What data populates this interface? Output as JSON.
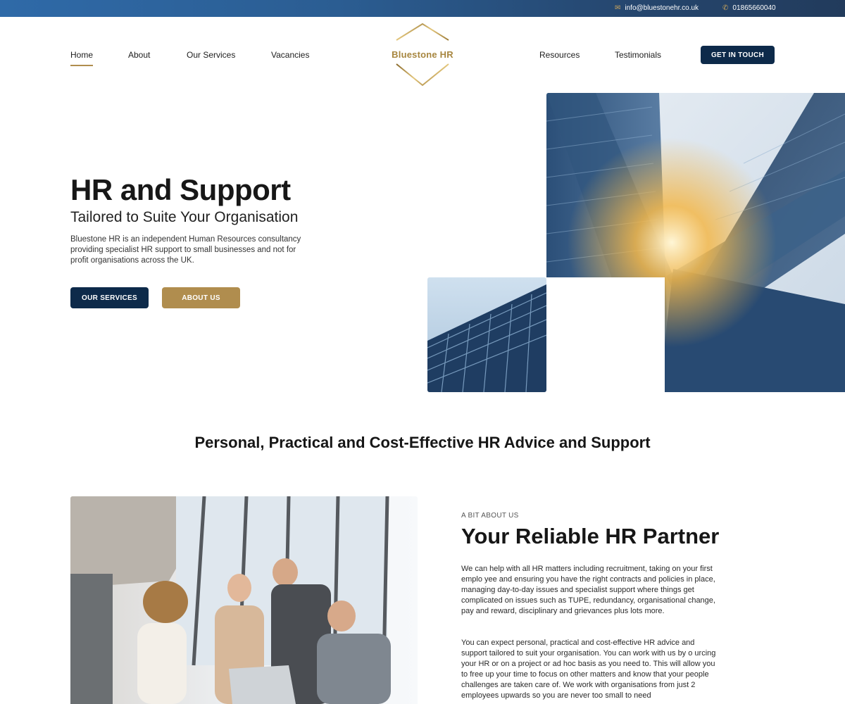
{
  "topbar": {
    "email": "info@bluestonehr.co.uk",
    "phone": "01865660040",
    "email_icon": "mail-icon",
    "phone_icon": "phone-icon"
  },
  "nav": {
    "left": [
      "Home",
      "About",
      "Our Services",
      "Vacancies"
    ],
    "right": [
      "Resources",
      "Testimonials"
    ],
    "active": "Home",
    "cta": "GET IN TOUCH"
  },
  "logo": {
    "text": "Bluestone HR"
  },
  "hero": {
    "title": "HR and Support",
    "subtitle": "Tailored to Suite Your Organisation",
    "description": "Bluestone HR is an independent Human Resources consultancy providing specialist HR support to small businesses and not for profit organisations across the UK.",
    "btn_services": "OUR SERVICES",
    "btn_about": "ABOUT US"
  },
  "section": {
    "heading": "Personal, Practical and Cost-Effective HR Advice and Support"
  },
  "about": {
    "eyebrow": "A BIT ABOUT US",
    "title": "Your Reliable HR Partner",
    "p1": "We can help with all HR matters including recruitment, taking on your first emplo yee and ensuring you have the right contracts and policies in place, managing day-to-day issues and specialist support where things get complicated on issues such as TUPE, redundancy, organisational change, pay and reward, disciplinary and grievances plus lots more.",
    "p2": "You can expect personal, practical and cost-effective HR advice and support tailored to suit your organisation. You can work with us by o urcing your HR or on a project or ad hoc basis as you need to. This will allow you to free up your time to focus on other matters and know that your people challenges are taken care of. We work with organisations from just 2 employees upwards so you are never too small to need"
  },
  "colors": {
    "navy": "#0d2a4a",
    "gold": "#b08d4e",
    "topbar": "#2b5d92"
  }
}
